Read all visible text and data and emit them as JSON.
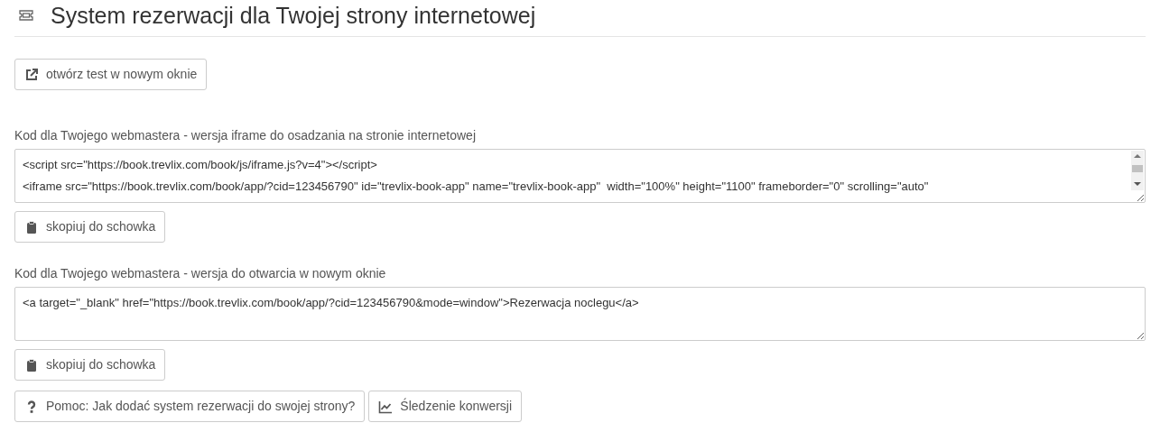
{
  "header": {
    "title": "System rezerwacji dla Twojej strony internetowej"
  },
  "open_test_button": {
    "label": "otwórz test w nowym oknie"
  },
  "code_sections": [
    {
      "label": "Kod dla Twojego webmastera - wersja iframe do osadzania na stronie internetowej",
      "lines": [
        "<script src=\"https://book.trevlix.com/book/js/iframe.js?v=4\"></script>",
        "<iframe src=\"https://book.trevlix.com/book/app/?cid=123456790\" id=\"trevlix-book-app\" name=\"trevlix-book-app\"  width=\"100%\" height=\"1100\" frameborder=\"0\" scrolling=\"auto\""
      ],
      "scrollable": true,
      "copy_button": "skopiuj do schowka"
    },
    {
      "label": "Kod dla Twojego webmastera - wersja do otwarcia w nowym oknie",
      "lines": [
        "<a target=\"_blank\" href=\"https://book.trevlix.com/book/app/?cid=123456790&mode=window\">Rezerwacja noclegu</a>"
      ],
      "scrollable": false,
      "copy_button": "skopiuj do schowka"
    }
  ],
  "bottom_buttons": [
    {
      "kind": "help",
      "label": "Pomoc: Jak dodać system rezerwacji do swojej strony?"
    },
    {
      "kind": "chart",
      "label": "Śledzenie konwersji"
    }
  ]
}
